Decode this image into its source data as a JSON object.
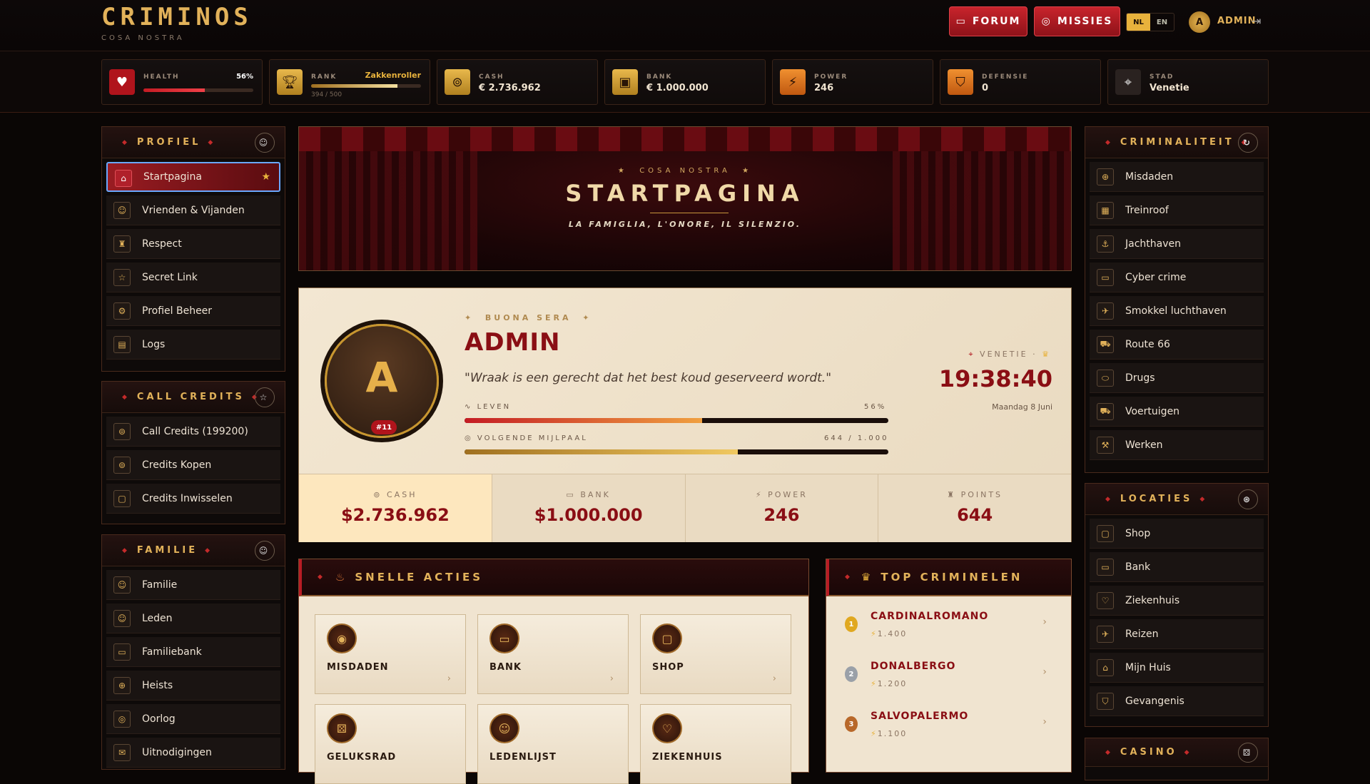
{
  "app": {
    "name": "CRIMINOS",
    "subtitle": "COSA NOSTRA"
  },
  "topnav": {
    "forum": "FORUM",
    "missies": "MISSIES",
    "lang_nl": "NL",
    "lang_en": "EN",
    "avatar_letter": "A",
    "user": "ADMIN"
  },
  "stats": {
    "health": {
      "label": "HEALTH",
      "pct_text": "56%",
      "pct": 56
    },
    "rank": {
      "label": "RANK",
      "name": "Zakkenroller",
      "progress": "394 / 500",
      "pct": 78.8
    },
    "cash": {
      "label": "CASH",
      "value": "€ 2.736.962"
    },
    "bank": {
      "label": "BANK",
      "value": "€ 1.000.000"
    },
    "power": {
      "label": "POWER",
      "value": "246"
    },
    "defensie": {
      "label": "DEFENSIE",
      "value": "0"
    },
    "stad": {
      "label": "STAD",
      "value": "Venetie"
    }
  },
  "sidebar_left": {
    "profiel": {
      "title": "PROFIEL",
      "items": [
        "Startpagina",
        "Vrienden & Vijanden",
        "Respect",
        "Secret Link",
        "Profiel Beheer",
        "Logs"
      ]
    },
    "credits": {
      "title": "CALL CREDITS",
      "items": [
        "Call Credits (199200)",
        "Credits Kopen",
        "Credits Inwisselen"
      ]
    },
    "familie": {
      "title": "FAMILIE",
      "items": [
        "Familie",
        "Leden",
        "Familiebank",
        "Heists",
        "Oorlog",
        "Uitnodigingen"
      ]
    }
  },
  "hero": {
    "kicker": "COSA NOSTRA",
    "title": "STARTPAGINA",
    "tagline": "LA FAMIGLIA, L'ONORE, IL SILENZIO."
  },
  "profile": {
    "greeting": "BUONA SERA",
    "name": "ADMIN",
    "avatar_letter": "A",
    "rank_badge": "#11",
    "quote": "\"Wraak is een gerecht dat het best koud geserveerd wordt.\"",
    "leven_label": "LEVEN",
    "leven_pct_text": "56%",
    "leven_pct": 56,
    "mijlpaal_label": "VOLGENDE MIJLPAAL",
    "mijlpaal_text": "644 / 1.000",
    "mijlpaal_pct": 64.4,
    "location": "VENETIE",
    "time": "19:38:40",
    "date": "Maandag 8 Juni",
    "tiles": [
      {
        "label": "CASH",
        "value": "$2.736.962"
      },
      {
        "label": "BANK",
        "value": "$1.000.000"
      },
      {
        "label": "POWER",
        "value": "246"
      },
      {
        "label": "POINTS",
        "value": "644"
      }
    ]
  },
  "quick_actions": {
    "title": "SNELLE ACTIES",
    "items": [
      "MISDADEN",
      "BANK",
      "SHOP",
      "GELUKSRAD",
      "LEDENLIJST",
      "ZIEKENHUIS"
    ]
  },
  "top_criminals": {
    "title": "TOP CRIMINELEN",
    "items": [
      {
        "rank": "1",
        "name": "CARDINALROMANO",
        "points": "1.400"
      },
      {
        "rank": "2",
        "name": "DONALBERGO",
        "points": "1.200"
      },
      {
        "rank": "3",
        "name": "SALVOPALERMO",
        "points": "1.100"
      }
    ]
  },
  "sidebar_right": {
    "criminaliteit": {
      "title": "CRIMINALITEIT",
      "items": [
        "Misdaden",
        "Treinroof",
        "Jachthaven",
        "Cyber crime",
        "Smokkel luchthaven",
        "Route 66",
        "Drugs",
        "Voertuigen",
        "Werken"
      ]
    },
    "locaties": {
      "title": "LOCATIES",
      "items": [
        "Shop",
        "Bank",
        "Ziekenhuis",
        "Reizen",
        "Mijn Huis",
        "Gevangenis"
      ]
    },
    "casino": {
      "title": "CASINO"
    }
  },
  "colors": {
    "accent_gold": "#e2b25a",
    "accent_red": "#b0141c",
    "cream": "#f0e4d0"
  }
}
